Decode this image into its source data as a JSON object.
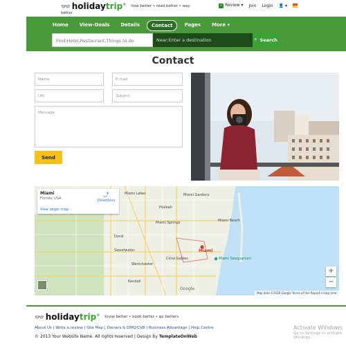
{
  "brand": {
    "name_part1": "holiday",
    "name_part2": "trip",
    "registered": "®",
    "eyes": "👓",
    "tagline": "how better • read better • way",
    "tagline_sub": "better"
  },
  "topnav": {
    "review": "Review ▾",
    "join": "Join",
    "login": "Login",
    "user": "👤 ▾"
  },
  "menu": {
    "items": [
      {
        "label": "Home"
      },
      {
        "label": "View-Deals"
      },
      {
        "label": "Details"
      },
      {
        "label": "Contact",
        "active": true
      },
      {
        "label": "Pages"
      },
      {
        "label": "More ▾"
      }
    ]
  },
  "search": {
    "find_placeholder": "Find:Hotel,Restaurant,Things to do",
    "near_placeholder": "Near:Enter a destination",
    "button_label": "Search",
    "button_icon": "🔍"
  },
  "page_title": "Contact",
  "form": {
    "name_placeholder": "Name",
    "email_placeholder": "E-mail",
    "url_placeholder": "URl",
    "subject_placeholder": "Subject",
    "message_placeholder": "Message",
    "send_label": "Send"
  },
  "map": {
    "place_name": "Miami",
    "place_sub": "Florida, USA",
    "directions_label": "Directions",
    "larger_map_label": "View larger map",
    "labels": [
      "Hialeah",
      "Miami Gardens",
      "Miami Springs",
      "Miami Lakes",
      "Miami Beach",
      "Miami",
      "Miami Seaquarium",
      "Coral Gables",
      "Kendall",
      "Doral",
      "Westchester",
      "Sweetwater"
    ],
    "attribution": "Map data ©2020 Google   Terms of Use   Report a map error",
    "google": "Google",
    "zoom_in": "+",
    "zoom_out": "−"
  },
  "footer": {
    "tagline": "know better • book better • go betters",
    "links": "About Us | Write a review | Site Map | Owners & DMO/CVB | Business Advantage | Help Centre",
    "copyright": "© 2013 Your Website Name. All rights reserved | Design by ",
    "designer": "TemplateOnWeb"
  },
  "watermark": {
    "title": "Activate Windows",
    "sub": "Go to Settings to activate Windows."
  }
}
